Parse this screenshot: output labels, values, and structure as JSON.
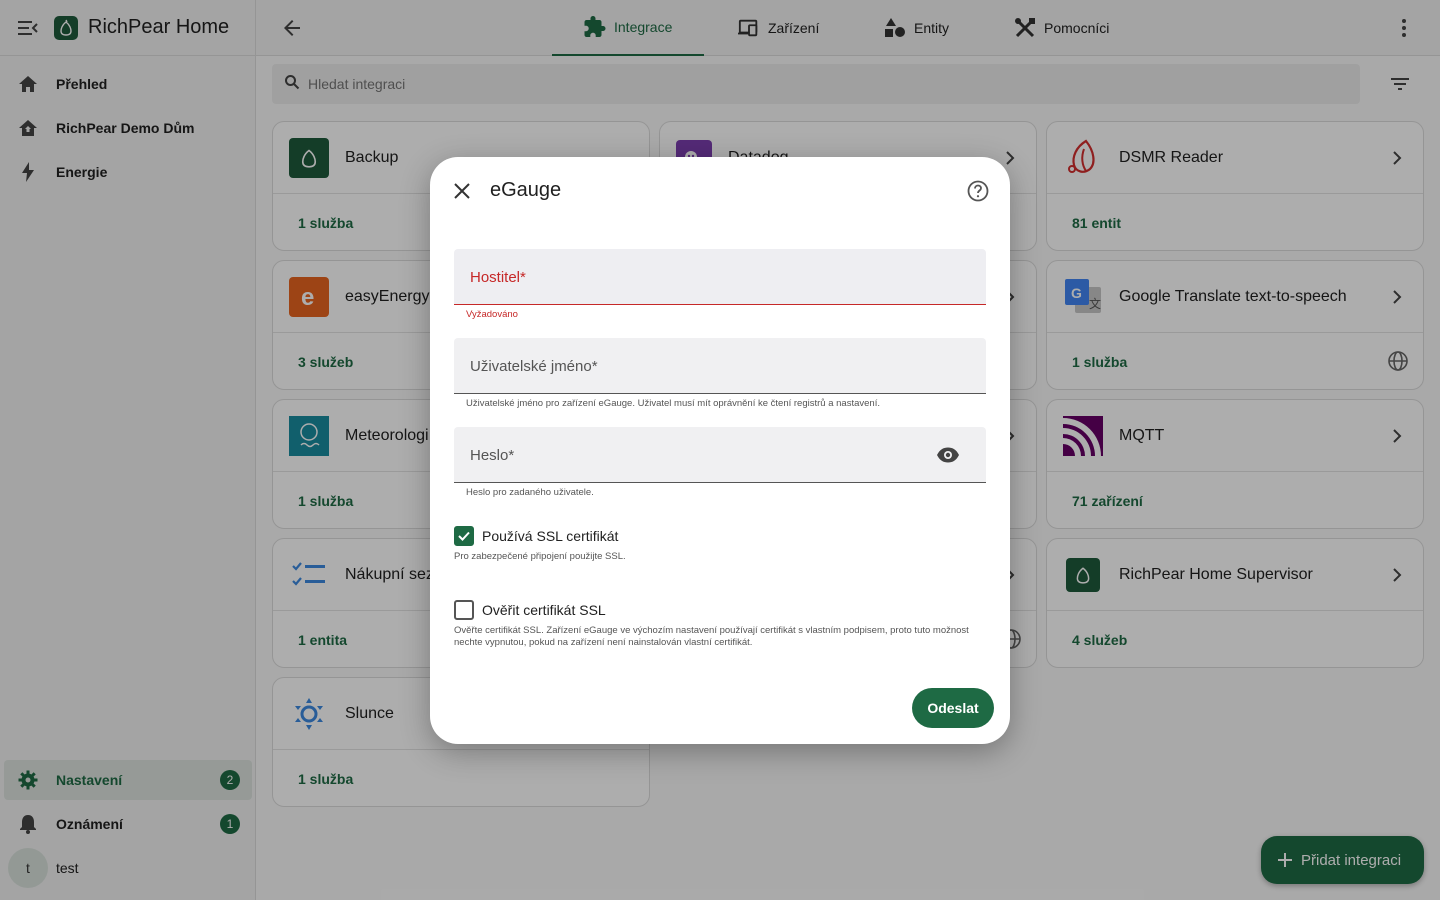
{
  "app": {
    "title": "RichPear Home"
  },
  "sidebar": {
    "items": [
      {
        "label": "Přehled"
      },
      {
        "label": "RichPear Demo Dům"
      },
      {
        "label": "Energie"
      }
    ],
    "bottom": [
      {
        "label": "Nastavení",
        "badge": "2"
      },
      {
        "label": "Oznámení",
        "badge": "1"
      }
    ],
    "user": {
      "initial": "t",
      "name": "test"
    }
  },
  "tabs": [
    {
      "label": "Integrace"
    },
    {
      "label": "Zařízení"
    },
    {
      "label": "Entity"
    },
    {
      "label": "Pomocníci"
    }
  ],
  "search": {
    "placeholder": "Hledat integraci"
  },
  "cards": [
    {
      "name": "Backup",
      "count": "1 služba"
    },
    {
      "name": "Datadog",
      "count": ""
    },
    {
      "name": "DSMR Reader",
      "count": "81 entit"
    },
    {
      "name": "easyEnergy",
      "count": "3 služeb"
    },
    {
      "name": "Google Translate text-to-speech",
      "count": "1 služba"
    },
    {
      "name": "Meteorologi",
      "count": "1 služba"
    },
    {
      "name": "MQTT",
      "count": "71 zařízení"
    },
    {
      "name": "Nákupní sez",
      "count": "1 entita"
    },
    {
      "name": "RichPear Home Supervisor",
      "count": "4 služeb"
    },
    {
      "name": "Slunce",
      "count": "1 služba"
    }
  ],
  "fab": {
    "label": "Přidat integraci"
  },
  "dialog": {
    "title": "eGauge",
    "fields": {
      "host": {
        "label": "Hostitel*",
        "helper": "Vyžadováno"
      },
      "username": {
        "label": "Uživatelské jméno*",
        "helper": "Uživatelské jméno pro zařízení eGauge. Uživatel musí mít oprávnění ke čtení registrů a nastavení."
      },
      "password": {
        "label": "Heslo*",
        "helper": "Heslo pro zadaného uživatele."
      }
    },
    "ssl": {
      "label": "Používá SSL certifikát",
      "helper": "Pro zabezpečené připojení použijte SSL.",
      "checked": true
    },
    "verify": {
      "label": "Ověřit certifikát SSL",
      "helper": "Ověřte certifikát SSL. Zařízení eGauge ve výchozím nastavení používají certifikát s vlastním podpisem, proto tuto možnost nechte vypnutou, pokud na zařízení není nainstalován vlastní certifikát.",
      "checked": false
    },
    "submit": "Odeslat"
  },
  "colors": {
    "primary": "#1e6a44",
    "error": "#c62828"
  }
}
